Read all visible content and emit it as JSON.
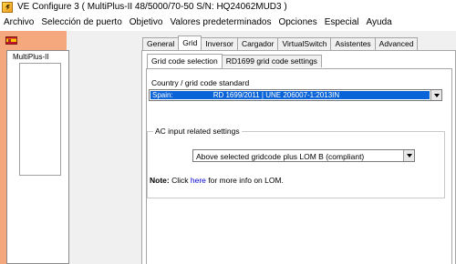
{
  "window": {
    "title": "VE Configure 3    ( MultiPlus-II 48/5000/70-50 S/N: HQ24062MUD3 )"
  },
  "menu": {
    "items": [
      "Archivo",
      "Selección de puerto",
      "Objetivo",
      "Valores predeterminados",
      "Opciones",
      "Especial",
      "Ayuda"
    ]
  },
  "left_panel": {
    "flag_icon": "spain-flag-icon",
    "device_label": "MultiPlus-II",
    "background_color": "#f5a77e"
  },
  "tabs": {
    "items": [
      "General",
      "Grid",
      "Inversor",
      "Cargador",
      "VirtualSwitch",
      "Asistentes",
      "Advanced"
    ],
    "active": "Grid"
  },
  "subtabs": {
    "items": [
      "Grid code selection",
      "RD1699 grid code settings"
    ],
    "active": "Grid code selection"
  },
  "grid_code": {
    "label": "Country / grid code standard",
    "country": "Spain:",
    "standard": "RD 1699/2011  |  UNE 206007-1:2013IN",
    "selection_color": "#0a64d8"
  },
  "ac_input": {
    "group_label": "AC input related settings",
    "selected_option": "Above selected gridcode plus LOM B (compliant)"
  },
  "note": {
    "prefix": "Note:",
    "text_before": " Click ",
    "link_text": "here",
    "text_after": " for more info on LOM.",
    "link_color": "#0000cc"
  }
}
